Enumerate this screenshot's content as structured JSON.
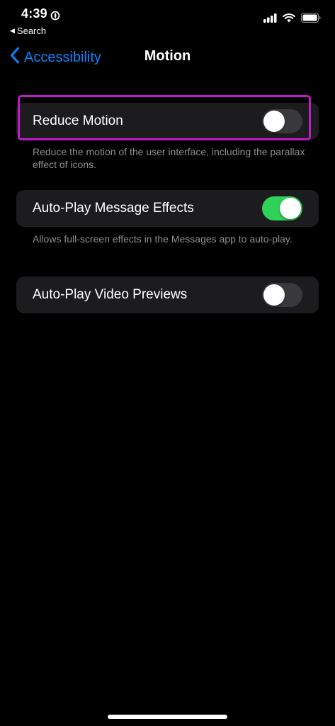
{
  "status_bar": {
    "time": "4:39",
    "back_app_label": "Search",
    "icons": [
      "focus-moon-icon",
      "cellular-signal-icon",
      "wifi-icon",
      "battery-icon"
    ]
  },
  "nav": {
    "back_label": "Accessibility",
    "title": "Motion"
  },
  "settings": [
    {
      "label": "Reduce Motion",
      "enabled": false,
      "footer": "Reduce the motion of the user interface, including the parallax effect of icons."
    },
    {
      "label": "Auto-Play Message Effects",
      "enabled": true,
      "footer": "Allows full-screen effects in the Messages app to auto-play."
    },
    {
      "label": "Auto-Play Video Previews",
      "enabled": false,
      "footer": ""
    }
  ],
  "colors": {
    "accent": "#0a84ff",
    "toggle_on": "#30d158",
    "toggle_off": "#39393d",
    "cell_background": "#1c1c1e",
    "highlight": "#c318c9"
  }
}
